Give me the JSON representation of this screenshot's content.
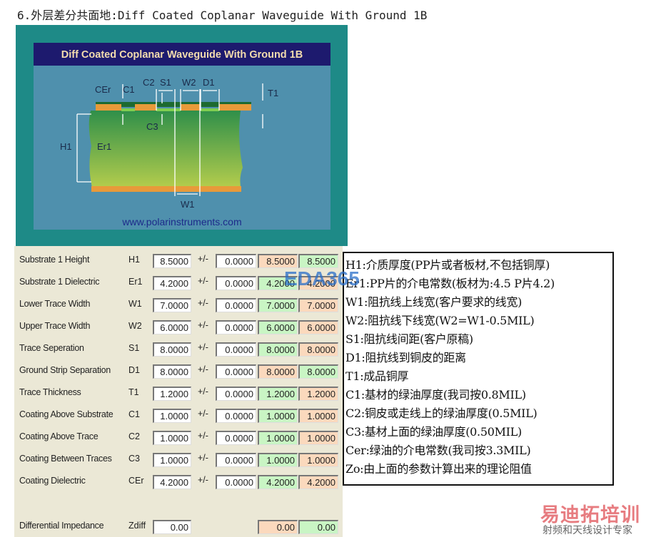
{
  "heading": "6.外层差分共面地:Diff Coated Coplanar Waveguide With Ground 1B",
  "figure": {
    "title": "Diff Coated Coplanar Waveguide With Ground 1B",
    "url": "www.polarinstruments.com",
    "labels": {
      "cer": "CEr",
      "c1": "C1",
      "c2": "C2",
      "s1": "S1",
      "w2": "W2",
      "d1": "D1",
      "t1": "T1",
      "c3": "C3",
      "h1": "H1",
      "er1": "Er1",
      "w1": "W1"
    }
  },
  "form": {
    "tolerance_label": "+/-",
    "rows": [
      {
        "label": "Substrate 1 Height",
        "symbol": "H1",
        "value": "8.5000",
        "tol": "0.0000",
        "min": "8.5000",
        "max": "8.5000",
        "min_color": "peach",
        "max_color": "green"
      },
      {
        "label": "Substrate 1 Dielectric",
        "symbol": "Er1",
        "value": "4.2000",
        "tol": "0.0000",
        "min": "4.2000",
        "max": "4.2000",
        "min_color": "green",
        "max_color": "peach"
      },
      {
        "label": "Lower Trace Width",
        "symbol": "W1",
        "value": "7.0000",
        "tol": "0.0000",
        "min": "7.0000",
        "max": "7.0000",
        "min_color": "green",
        "max_color": "peach"
      },
      {
        "label": "Upper Trace Width",
        "symbol": "W2",
        "value": "6.0000",
        "tol": "0.0000",
        "min": "6.0000",
        "max": "6.0000",
        "min_color": "green",
        "max_color": "peach"
      },
      {
        "label": "Trace Seperation",
        "symbol": "S1",
        "value": "8.0000",
        "tol": "0.0000",
        "min": "8.0000",
        "max": "8.0000",
        "min_color": "green",
        "max_color": "peach"
      },
      {
        "label": "Ground Strip Separation",
        "symbol": "D1",
        "value": "8.0000",
        "tol": "0.0000",
        "min": "8.0000",
        "max": "8.0000",
        "min_color": "peach",
        "max_color": "green"
      },
      {
        "label": "Trace Thickness",
        "symbol": "T1",
        "value": "1.2000",
        "tol": "0.0000",
        "min": "1.2000",
        "max": "1.2000",
        "min_color": "green",
        "max_color": "peach"
      },
      {
        "label": "Coating Above Substrate",
        "symbol": "C1",
        "value": "1.0000",
        "tol": "0.0000",
        "min": "1.0000",
        "max": "1.0000",
        "min_color": "green",
        "max_color": "peach"
      },
      {
        "label": "Coating Above Trace",
        "symbol": "C2",
        "value": "1.0000",
        "tol": "0.0000",
        "min": "1.0000",
        "max": "1.0000",
        "min_color": "green",
        "max_color": "peach"
      },
      {
        "label": "Coating Between Traces",
        "symbol": "C3",
        "value": "1.0000",
        "tol": "0.0000",
        "min": "1.0000",
        "max": "1.0000",
        "min_color": "green",
        "max_color": "peach"
      },
      {
        "label": "Coating Dielectric",
        "symbol": "CEr",
        "value": "4.2000",
        "tol": "0.0000",
        "min": "4.2000",
        "max": "4.2000",
        "min_color": "green",
        "max_color": "peach"
      }
    ],
    "result": {
      "label": "Differential Impedance",
      "symbol": "Zdiff",
      "value": "0.00",
      "min": "0.00",
      "max": "0.00",
      "min_color": "peach",
      "max_color": "green"
    }
  },
  "notes": [
    "H1:介质厚度(PP片或者板材,不包括铜厚)",
    "Er1:PP片的介电常数(板材为:4.5 P片4.2)",
    "W1:阻抗线上线宽(客户要求的线宽)",
    "W2:阻抗线下线宽(W2=W1-0.5MIL)",
    "S1:阻抗线间距(客户原稿)",
    "D1:阻抗线到铜皮的距离",
    "T1:成品铜厚",
    "C1:基材的绿油厚度(我司按0.8MIL)",
    "C2:铜皮或走线上的绿油厚度(0.5MIL)",
    "C3:基材上面的绿油厚度(0.50MIL)",
    "Cer:绿油的介电常数(我司按3.3MIL)",
    "Zo:由上面的参数计算出来的理论阻值"
  ],
  "watermarks": {
    "eda": "EDA365",
    "brand": "易迪拓培训",
    "tagline": "射频和天线设计专家"
  },
  "colors": {
    "green": "#c9f5c4",
    "peach": "#fbd9bd",
    "teal": "#1e8a87",
    "navy": "#1d1a6e",
    "title_text": "#f3dcae"
  }
}
